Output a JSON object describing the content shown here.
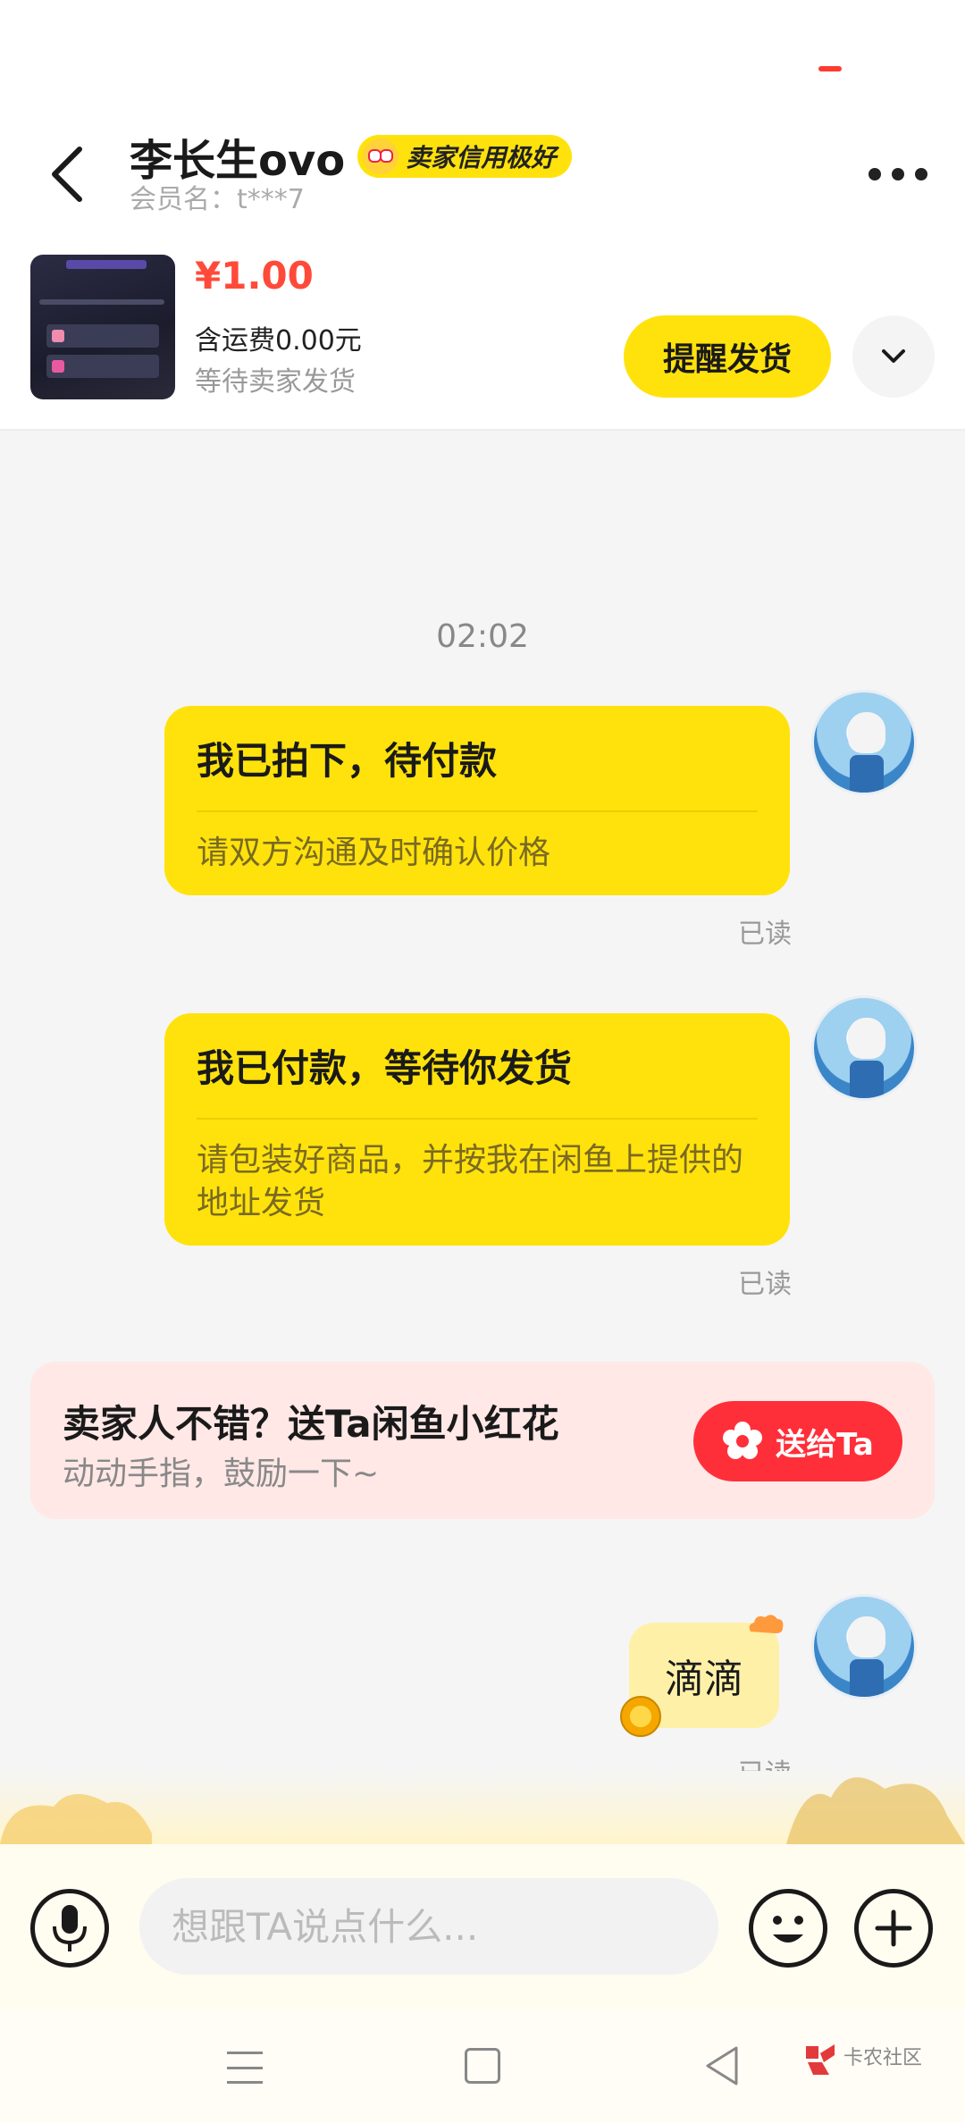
{
  "header": {
    "seller_name": "李长生ovo",
    "credit_badge": "卖家信用极好",
    "member_name": "会员名：t***7"
  },
  "order": {
    "price": "¥1.00",
    "shipping": "含运费0.00元",
    "status": "等待卖家发货",
    "remind_button": "提醒发货"
  },
  "chat": {
    "time": "02:02",
    "messages": [
      {
        "title": "我已拍下，待付款",
        "sub": "请双方沟通及时确认价格",
        "read": "已读"
      },
      {
        "title": "我已付款，等待你发货",
        "sub": "请包装好商品，并按我在闲鱼上提供的地址发货",
        "read": "已读"
      }
    ],
    "flower_banner": {
      "title": "卖家人不错？送Ta闲鱼小红花",
      "sub": "动动手指，鼓励一下~",
      "button": "送给Ta"
    },
    "text_message": "滴滴",
    "text_read": "已读"
  },
  "input": {
    "placeholder": "想跟TA说点什么..."
  },
  "watermark": {
    "line1": "卡农社区"
  },
  "colors": {
    "accent_yellow": "#ffe20c",
    "price_red": "#ff4a3a",
    "flower_red": "#ff2f3a"
  },
  "icons": [
    "back-icon",
    "more-icon",
    "chevron-down-icon",
    "mic-icon",
    "emoji-icon",
    "plus-icon",
    "flower-icon",
    "coin-icon"
  ]
}
